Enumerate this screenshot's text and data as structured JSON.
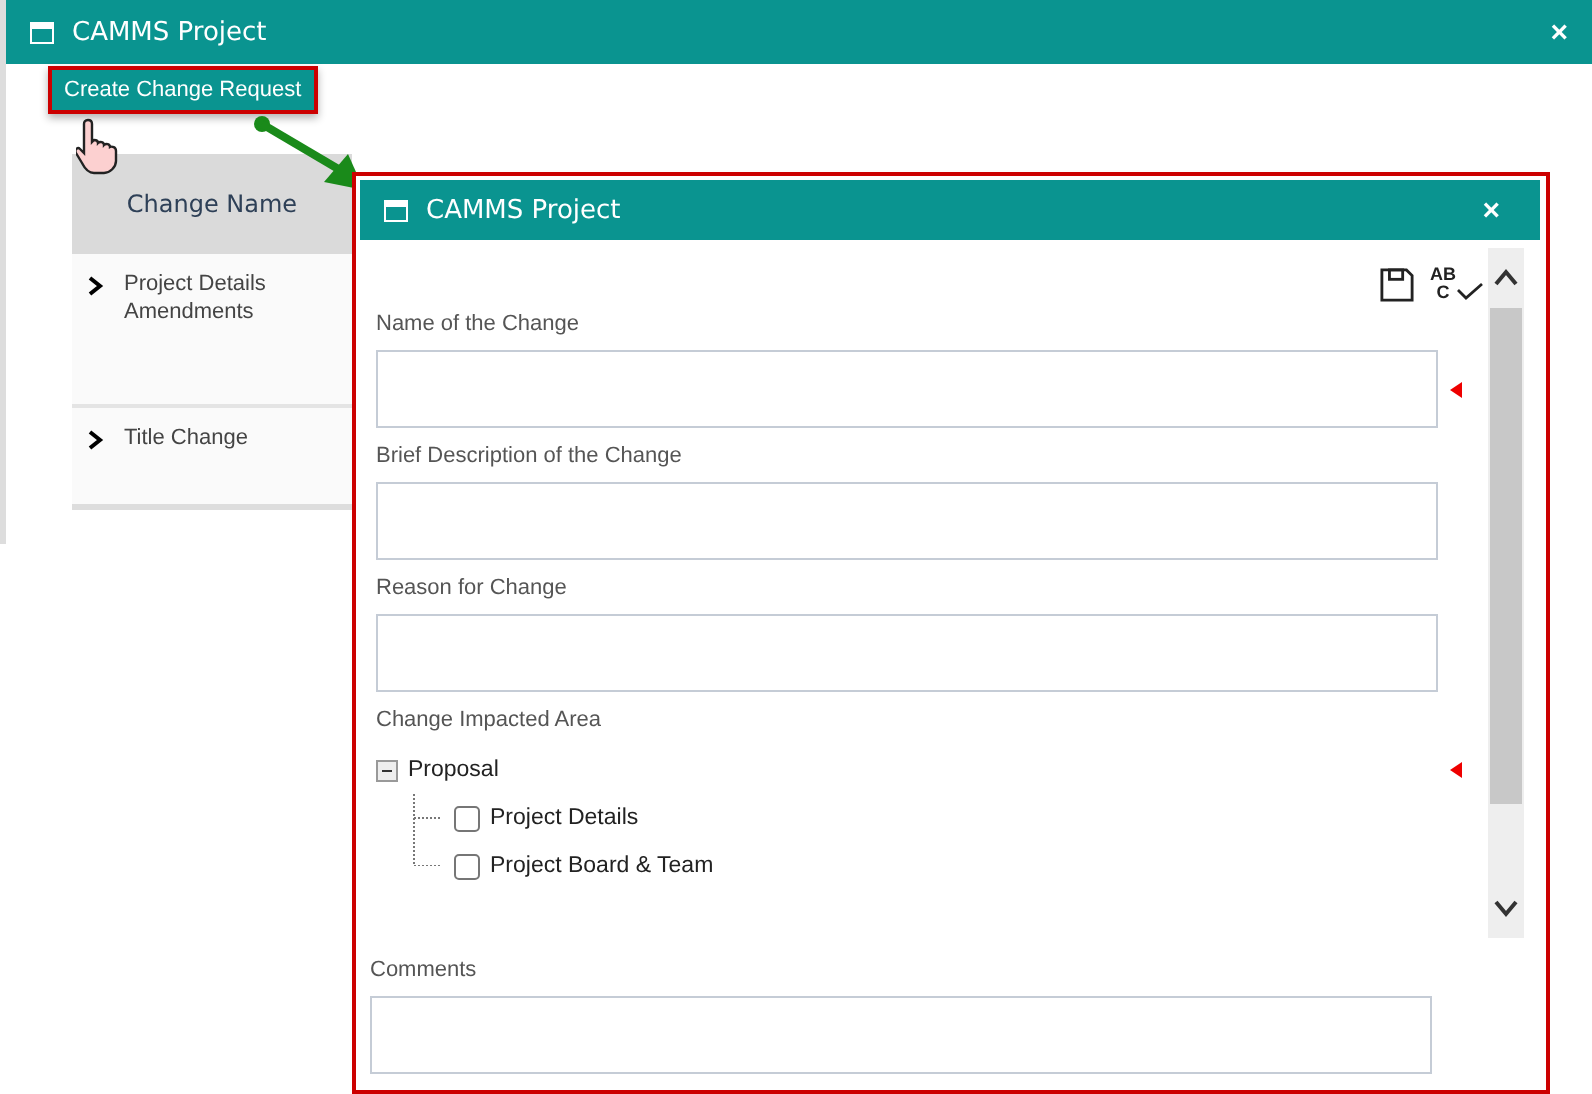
{
  "window": {
    "title": "CAMMS Project",
    "close": "×"
  },
  "create_button": {
    "label": "Create Change Request",
    "highlighted": true
  },
  "table": {
    "columns": [
      "Change Name"
    ],
    "rows": [
      {
        "name": "Project Details Amendments",
        "expanded": false
      },
      {
        "name": "Title Change",
        "expanded": false
      }
    ]
  },
  "dialog": {
    "title": "CAMMS Project",
    "close": "×",
    "highlighted": true,
    "spellcheck": [
      "AB",
      "C"
    ],
    "fields": [
      {
        "kind": "text",
        "label": "Name of the Change",
        "required": true
      },
      {
        "kind": "text",
        "label": "Brief Description of the Change",
        "required": false
      },
      {
        "kind": "text",
        "label": "Reason for Change",
        "required": false
      },
      {
        "kind": "tree",
        "label": "Change Impacted Area",
        "required": true,
        "tree": [
          {
            "label": "Proposal",
            "expanded": true,
            "children": [
              {
                "label": "Project Details",
                "checked": false
              },
              {
                "label": "Project Board & Team",
                "checked": false
              }
            ]
          }
        ]
      }
    ],
    "comments": {
      "label": "Comments"
    }
  }
}
